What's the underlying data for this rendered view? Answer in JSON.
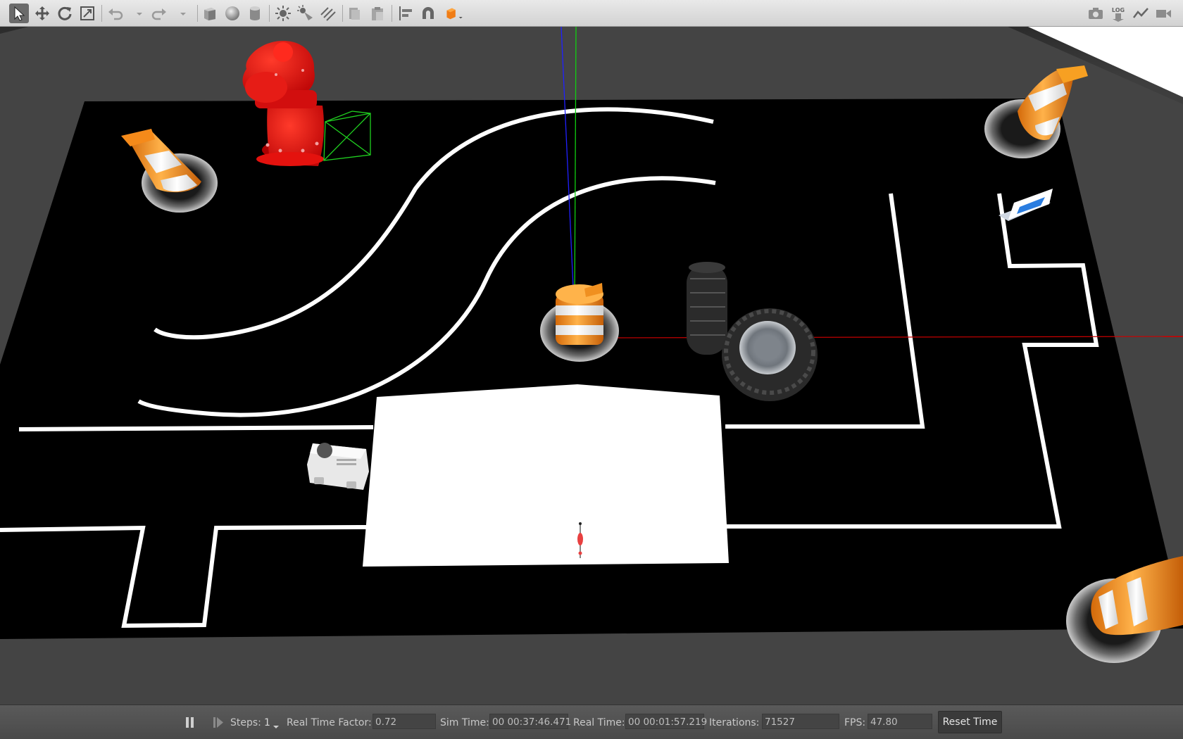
{
  "toolbar": {
    "left_tools": [
      "select-icon",
      "translate-icon",
      "rotate-icon",
      "scale-icon",
      "undo-icon",
      "redo-icon",
      "box-icon",
      "sphere-icon",
      "cylinder-icon",
      "point-light-icon",
      "spot-light-icon",
      "directional-light-icon",
      "copy-icon",
      "paste-icon",
      "align-icon",
      "snap-icon",
      "view-angle-icon"
    ],
    "right_tools": [
      "screenshot-icon",
      "log-icon",
      "plot-icon",
      "record-video-icon"
    ],
    "log_label": "LOG"
  },
  "status": {
    "steps_label": "Steps:",
    "steps_value": "1",
    "rtf_label": "Real Time Factor:",
    "rtf_value": "0.72",
    "sim_time_label": "Sim Time:",
    "sim_time_value": "00 00:37:46.471",
    "real_time_label": "Real Time:",
    "real_time_value": "00 00:01:57.219",
    "iterations_label": "Iterations:",
    "iterations_value": "71527",
    "fps_label": "FPS:",
    "fps_value": "47.80",
    "reset_label": "Reset Time"
  },
  "scene": {
    "objects": [
      "track-mat",
      "fire-hydrant",
      "traffic-cone",
      "construction-barrel",
      "tire",
      "mobile-robot",
      "parking-sign",
      "start-pad"
    ],
    "colors": {
      "mat": "#000000",
      "lines": "#ffffff",
      "hydrant": "#e01010",
      "cone": "#f7961b",
      "x_axis": "#cc0000",
      "y_axis": "#10c010",
      "z_axis": "#1010dd"
    }
  }
}
